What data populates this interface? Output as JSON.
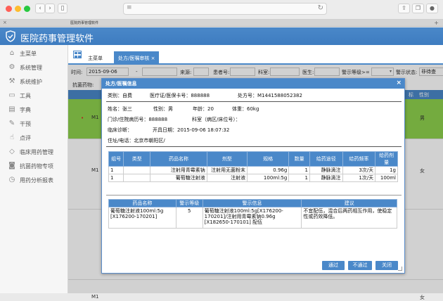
{
  "browser": {
    "tab_title": "医院药事管理软件",
    "colors": {
      "close": "#ff5f57",
      "minimize": "#febc2e",
      "maximize": "#28c840"
    }
  },
  "app": {
    "title": "医院药事管理软件",
    "accent": "#4a88c9"
  },
  "sidebar": {
    "items": [
      {
        "icon": "home-icon",
        "label": "主菜单"
      },
      {
        "icon": "gear-icon",
        "label": "系统管理"
      },
      {
        "icon": "wrench-icon",
        "label": "系统维护"
      },
      {
        "icon": "toolbox-icon",
        "label": "工具"
      },
      {
        "icon": "book-icon",
        "label": "字典"
      },
      {
        "icon": "pen-icon",
        "label": "干预"
      },
      {
        "icon": "thumbs-up-icon",
        "label": "点评"
      },
      {
        "icon": "tag-icon",
        "label": "临床用药管理"
      },
      {
        "icon": "camera-icon",
        "label": "抗菌药物专项"
      },
      {
        "icon": "clock-icon",
        "label": "用药分析报表"
      }
    ]
  },
  "tabs": {
    "home": "主菜单",
    "active": "处方/医嘱审核",
    "active_close": "×"
  },
  "filter": {
    "date_label": "时间:",
    "date_from": "2015-09-06",
    "dash": "-",
    "source_label": "来源:",
    "patient_label": "患者号:",
    "dept_label": "科室:",
    "doctor_label": "医生:",
    "warn_level_label": "警示等级>=",
    "warn_state_label": "警示状态:",
    "warn_state_value": "非待查"
  },
  "antibiotic_label": "抗菌药物:",
  "bg_table": {
    "headers": [
      "标",
      "性别"
    ],
    "rows": [
      {
        "mark": "•",
        "id": "M1",
        "gender": "男"
      },
      {
        "mark": "",
        "id": "M1",
        "gender": "女"
      },
      {
        "mark": "",
        "id": "M1",
        "gender": "女"
      }
    ]
  },
  "modal": {
    "title": "处方/医嘱信息",
    "close": "×",
    "category": "类别：自费",
    "med_card": "医疗证/医保卡号：888888",
    "rx_no": "处方号：M1441588052382",
    "name": "姓名：张三",
    "sex": "性别：男",
    "age": "年龄：20",
    "weight": "体重：60kg",
    "clinic_no": "门诊/住院病历号：888888",
    "dept_bed": "科室（病区/床位号）：",
    "diagnosis": "临床诊断：",
    "open_date": "开具日期：2015-09-06 18:07:32",
    "address": "住址/电话：北京市朝阳区/",
    "drug_table": {
      "headers": [
        "组号",
        "类型",
        "药品名称",
        "剂型",
        "规格",
        "数量",
        "给药途径",
        "给药频率",
        "给药剂量"
      ],
      "rows": [
        [
          "1",
          "",
          "注射用青霉素钠",
          "注射用无菌粉末",
          "0.96g",
          "1",
          "静脉滴注",
          "3次/天",
          "1g"
        ],
        [
          "1",
          "",
          "葡萄糖注射液",
          "注射液",
          "100ml:5g",
          "1",
          "静脉滴注",
          "1次/天",
          "100ml"
        ]
      ]
    },
    "warn_table": {
      "headers": [
        "药品名称",
        "警示等级",
        "警示信息",
        "建议"
      ],
      "rows": [
        [
          "葡萄糖注射液100ml:5g [X176200-170201]",
          "5",
          "葡萄糖注射液100ml:5g[X176200-170201]/注射用青霉素钠0.96g [X182650-170101] 配伍",
          "不宜配伍，混合后两药相互作用，使稳定性或药效降低。"
        ]
      ]
    },
    "buttons": {
      "pass": "通过",
      "reject": "不通过",
      "close": "关闭"
    }
  }
}
